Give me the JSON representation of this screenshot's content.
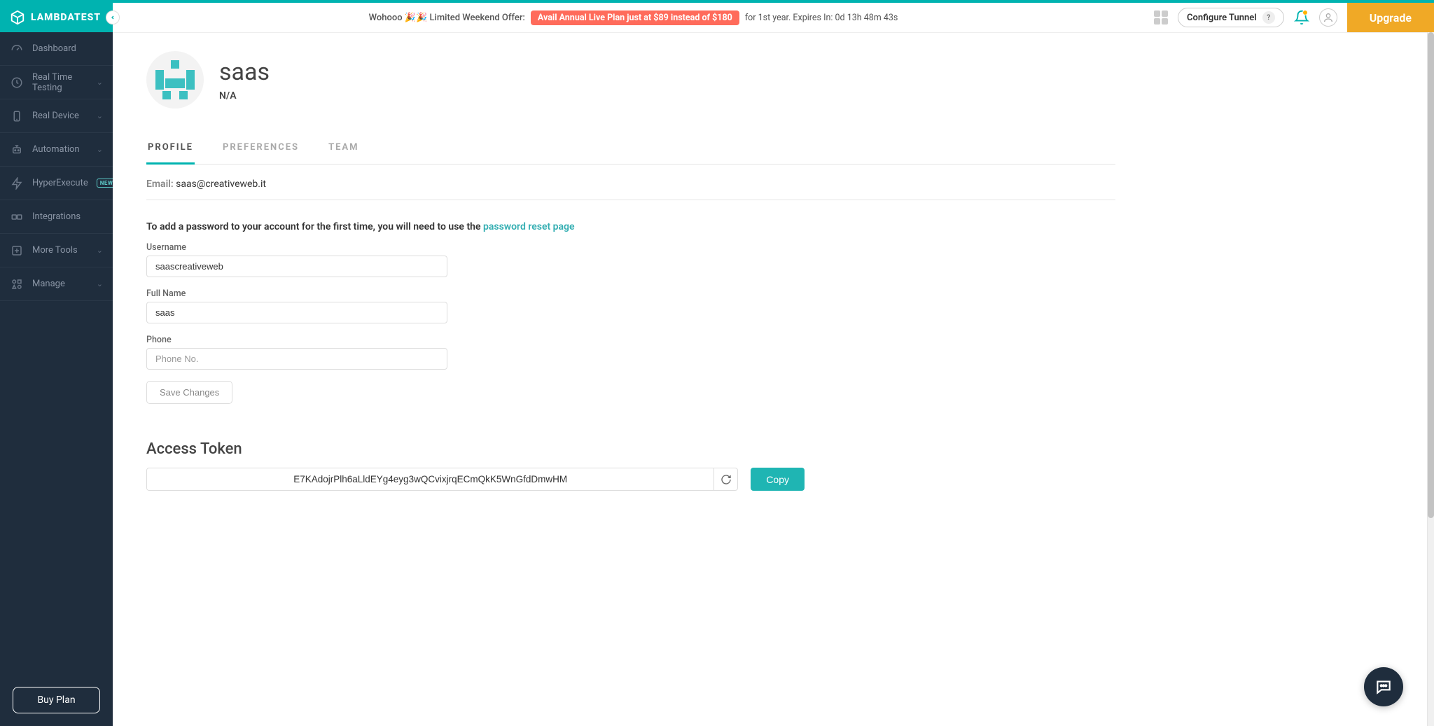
{
  "brand": {
    "text": "LAMBDATEST"
  },
  "header": {
    "wohoo": "Wohooo 🎉🎉 Limited Weekend Offer:",
    "offer_pill": "Avail Annual Live Plan just at $89 instead of $180",
    "expires": "for 1st year. Expires In: 0d 13h 48m 43s",
    "configure_tunnel": "Configure Tunnel",
    "upgrade": "Upgrade"
  },
  "sidebar": {
    "items": [
      {
        "label": "Dashboard"
      },
      {
        "label": "Real Time Testing"
      },
      {
        "label": "Real Device"
      },
      {
        "label": "Automation"
      },
      {
        "label": "HyperExecute"
      },
      {
        "label": "Integrations"
      },
      {
        "label": "More Tools"
      },
      {
        "label": "Manage"
      }
    ],
    "new_badge": "NEW",
    "buy_plan": "Buy Plan"
  },
  "profile": {
    "name": "saas",
    "subtitle": "N/A",
    "tabs": {
      "profile": "PROFILE",
      "preferences": "PREFERENCES",
      "team": "TEAM"
    },
    "email_label": "Email:",
    "email_value": "saas@creativeweb.it",
    "pw_hint_prefix": "To add a password to your account for the first time, you will need to use the ",
    "pw_hint_link": "password reset page",
    "username_label": "Username",
    "username_value": "saascreativeweb",
    "fullname_label": "Full Name",
    "fullname_value": "saas",
    "phone_label": "Phone",
    "phone_placeholder": "Phone No.",
    "save_changes": "Save Changes",
    "access_token_title": "Access Token",
    "access_token_value": "E7KAdojrPlh6aLldEYg4eyg3wQCvixjrqECmQkK5WnGfdDmwHM",
    "copy": "Copy"
  }
}
